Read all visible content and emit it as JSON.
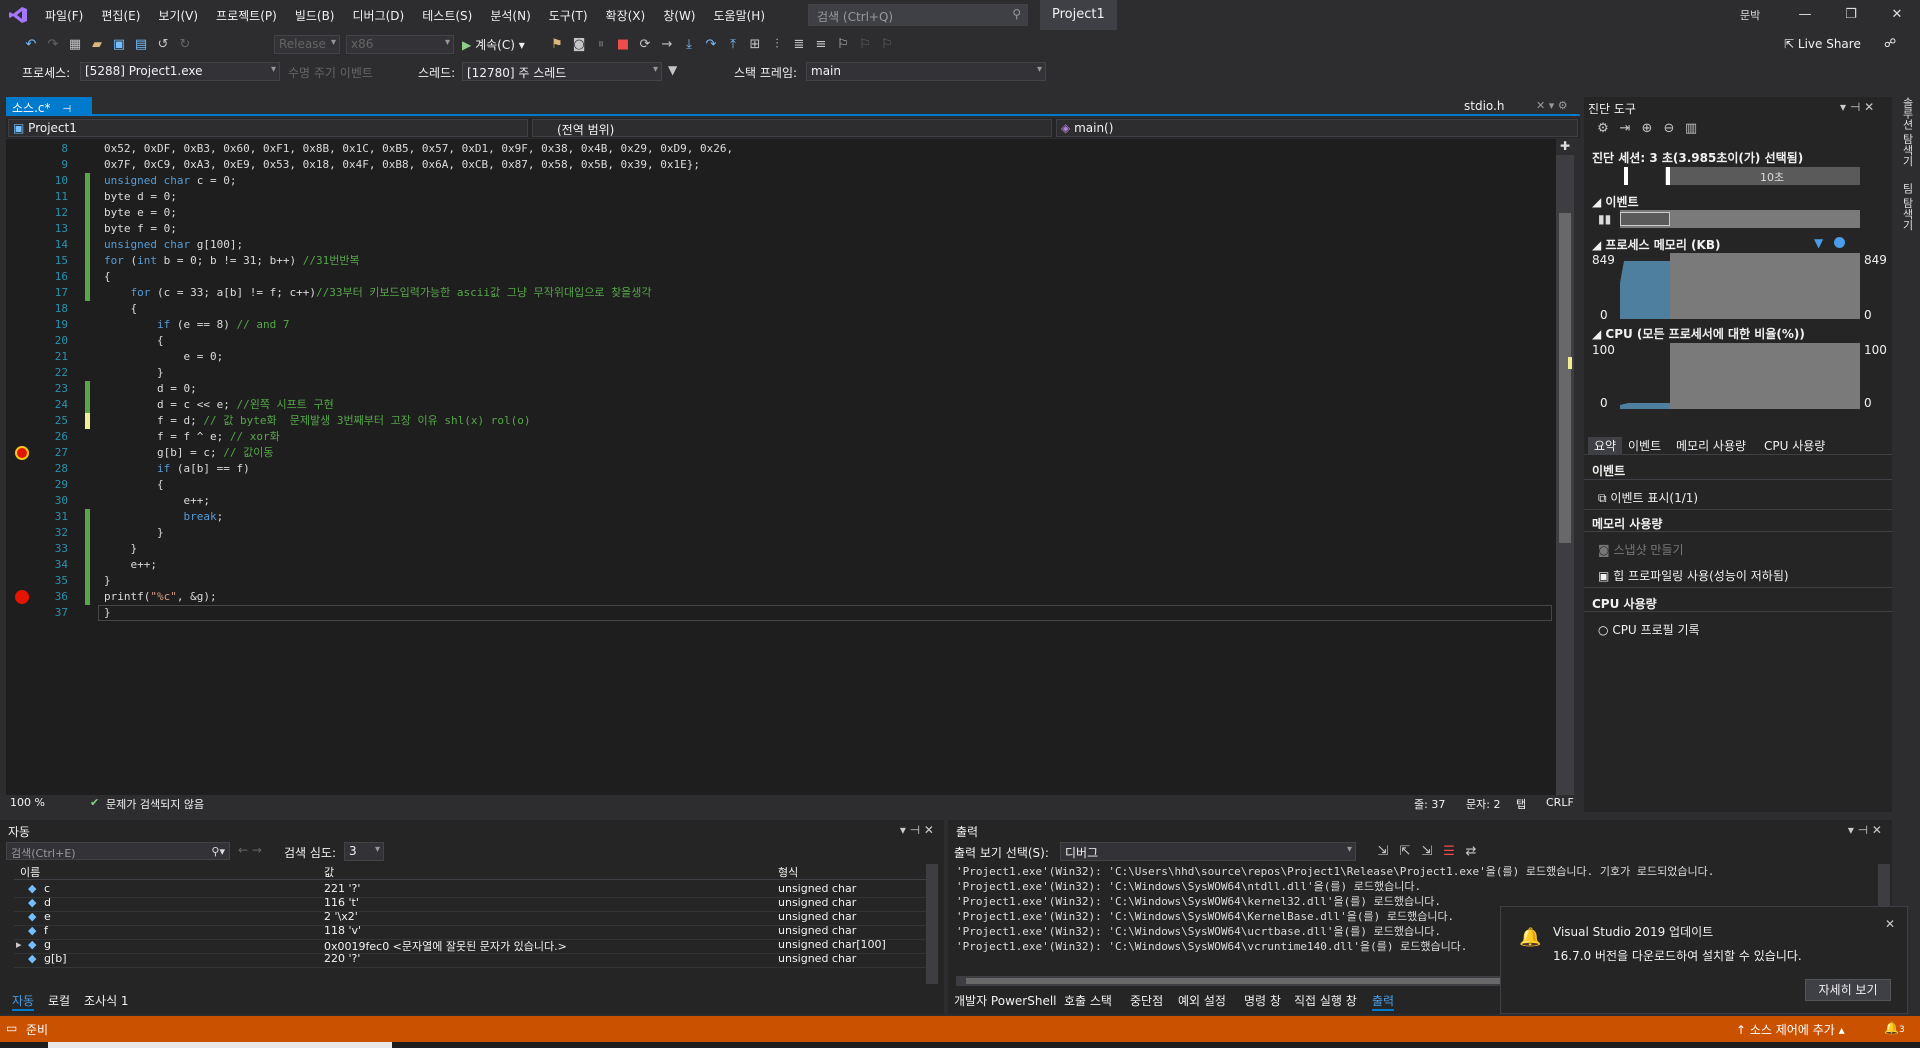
{
  "colors": {
    "accent": "#007acc",
    "status_bar": "#ca5100",
    "breakpoint": "#e51400",
    "change_green": "#57a64a"
  },
  "menu": [
    "파일(F)",
    "편집(E)",
    "보기(V)",
    "프로젝트(P)",
    "빌드(B)",
    "디버그(D)",
    "테스트(S)",
    "분석(N)",
    "도구(T)",
    "확장(X)",
    "창(W)",
    "도움말(H)"
  ],
  "search": {
    "placeholder": "검색 (Ctrl+Q)"
  },
  "title": "Project1",
  "user_badge": "문박",
  "live_share": "Live Share",
  "toolbar": {
    "config": "Release",
    "platform": "x86",
    "continue": "계속(C)"
  },
  "debugbar": {
    "process_label": "프로세스:",
    "process_value": "[5288] Project1.exe",
    "lifecycle": "수명 주기 이벤트",
    "thread_label": "스레드:",
    "thread_value": "[12780] 주 스레드",
    "stack_label": "스택 프레임:",
    "stack_value": "main"
  },
  "doc_tab": {
    "label": "소스.c*",
    "pin": "⊣",
    "close": "✕"
  },
  "header_tab": "stdio.h",
  "nav": {
    "project": "Project1",
    "scope": "(전역 범위)",
    "function": "main()"
  },
  "code_lines": [
    {
      "n": "8",
      "t": "0x52, 0xDF, 0xB3, 0x60, 0xF1, 0x8B, 0x1C, 0xB5, 0x57, 0xD1, 0x9F, 0x38, 0x4B, 0x29, 0xD9, 0x26,"
    },
    {
      "n": "9",
      "t": "0x7F, 0xC9, 0xA3, 0xE9, 0x53, 0x18, 0x4F, 0xB8, 0x6A, 0xCB, 0x87, 0x58, 0x5B, 0x39, 0x1E};"
    },
    {
      "n": "10",
      "t": "unsigned char c = 0;"
    },
    {
      "n": "11",
      "t": "byte d = 0;"
    },
    {
      "n": "12",
      "t": "byte e = 0;"
    },
    {
      "n": "13",
      "t": "byte f = 0;"
    },
    {
      "n": "14",
      "t": "unsigned char g[100];"
    },
    {
      "n": "15",
      "t": "for (int b = 0; b != 31; b++) //31번반복"
    },
    {
      "n": "16",
      "t": "{"
    },
    {
      "n": "17",
      "t": "    for (c = 33; a[b] != f; c++)//33부터 키보드입력가능한 ascii값 그냥 무작위대입으로 찾을생각"
    },
    {
      "n": "18",
      "t": "    {"
    },
    {
      "n": "19",
      "t": "        if (e == 8) // and 7"
    },
    {
      "n": "20",
      "t": "        {"
    },
    {
      "n": "21",
      "t": "            e = 0;"
    },
    {
      "n": "22",
      "t": "        }"
    },
    {
      "n": "23",
      "t": "        d = 0;"
    },
    {
      "n": "24",
      "t": "        d = c << e; //왼쪽 시프트 구현"
    },
    {
      "n": "25",
      "t": "        f = d; // 값 byte화  문제발생 3번째부터 고장 이유 shl(x) rol(o)"
    },
    {
      "n": "26",
      "t": "        f = f ^ e; // xor화"
    },
    {
      "n": "27",
      "t": "        g[b] = c; // 값이동"
    },
    {
      "n": "28",
      "t": "        if (a[b] == f)"
    },
    {
      "n": "29",
      "t": "        {"
    },
    {
      "n": "30",
      "t": "            e++;"
    },
    {
      "n": "31",
      "t": "            break;"
    },
    {
      "n": "32",
      "t": "        }"
    },
    {
      "n": "33",
      "t": "    }"
    },
    {
      "n": "34",
      "t": "    e++;"
    },
    {
      "n": "35",
      "t": "}"
    },
    {
      "n": "36",
      "t": "printf(\"%c\", &g);"
    },
    {
      "n": "37",
      "t": "}"
    }
  ],
  "editor_status": {
    "zoom": "100 %",
    "issues": "문제가 검색되지 않음",
    "line": "줄: 37",
    "col": "문자: 2",
    "tab": "탭",
    "eol": "CRLF"
  },
  "diag": {
    "title": "진단 도구",
    "session": "진단 세션: 3 초(3.985초이(가) 선택됨)",
    "timeline_mark": "10초",
    "events_label": "이벤트",
    "memory_label": "프로세스 메모리 (KB)",
    "mem_max": "849",
    "mem_min": "0",
    "cpu_label": "CPU (모든 프로세서에 대한 비율(%))",
    "cpu_max": "100",
    "cpu_min": "0",
    "tabs": [
      "요약",
      "이벤트",
      "메모리 사용량",
      "CPU 사용량"
    ],
    "sec_events": "이벤트",
    "show_events": "이벤트 표시(1/1)",
    "sec_memory": "메모리 사용량",
    "snapshot": "스냅샷 만들기",
    "heap": "힙 프로파일링 사용(성능이 저하됨)",
    "sec_cpu": "CPU 사용량",
    "cpu_profile": "CPU 프로필 기록"
  },
  "side_tabs": [
    "솔루션 탐색기",
    "팀 탐색기"
  ],
  "autos": {
    "title": "자동",
    "search_placeholder": "검색(Ctrl+E)",
    "depth_label": "검색 심도:",
    "depth": "3",
    "headers": [
      "이름",
      "값",
      "형식"
    ],
    "rows": [
      {
        "name": "c",
        "value": "221 '?'",
        "type": "unsigned char"
      },
      {
        "name": "d",
        "value": "116 't'",
        "type": "unsigned char"
      },
      {
        "name": "e",
        "value": "2 '\\x2'",
        "type": "unsigned char"
      },
      {
        "name": "f",
        "value": "118 'v'",
        "type": "unsigned char"
      },
      {
        "name": "g",
        "value": "0x0019fec0 <문자열에 잘못된 문자가 있습니다.>",
        "type": "unsigned char[100]"
      },
      {
        "name": "g[b]",
        "value": "220 '?'",
        "type": "unsigned char"
      }
    ],
    "tabs": [
      "자동",
      "로컬",
      "조사식 1"
    ]
  },
  "output": {
    "title": "출력",
    "source_label": "출력 보기 선택(S):",
    "source": "디버그",
    "lines": [
      "'Project1.exe'(Win32): 'C:\\Users\\hhd\\source\\repos\\Project1\\Release\\Project1.exe'을(를) 로드했습니다. 기호가 로드되었습니다.",
      "'Project1.exe'(Win32): 'C:\\Windows\\SysWOW64\\ntdll.dll'을(를) 로드했습니다.",
      "'Project1.exe'(Win32): 'C:\\Windows\\SysWOW64\\kernel32.dll'을(를) 로드했습니다.",
      "'Project1.exe'(Win32): 'C:\\Windows\\SysWOW64\\KernelBase.dll'을(를) 로드했습니다.",
      "'Project1.exe'(Win32): 'C:\\Windows\\SysWOW64\\ucrtbase.dll'을(를) 로드했습니다.",
      "'Project1.exe'(Win32): 'C:\\Windows\\SysWOW64\\vcruntime140.dll'을(를) 로드했습니다."
    ],
    "tabs": [
      "개발자 PowerShell",
      "호출 스택",
      "중단점",
      "예외 설정",
      "명령 창",
      "직접 실행 창",
      "출력"
    ]
  },
  "toast": {
    "title": "Visual Studio 2019 업데이트",
    "body": "16.7.0 버전을 다운로드하여 설치할 수 있습니다.",
    "button": "자세히 보기"
  },
  "statusbar": {
    "ready": "준비",
    "source_control": "소스 제어에 추가",
    "notif_count": "3"
  }
}
